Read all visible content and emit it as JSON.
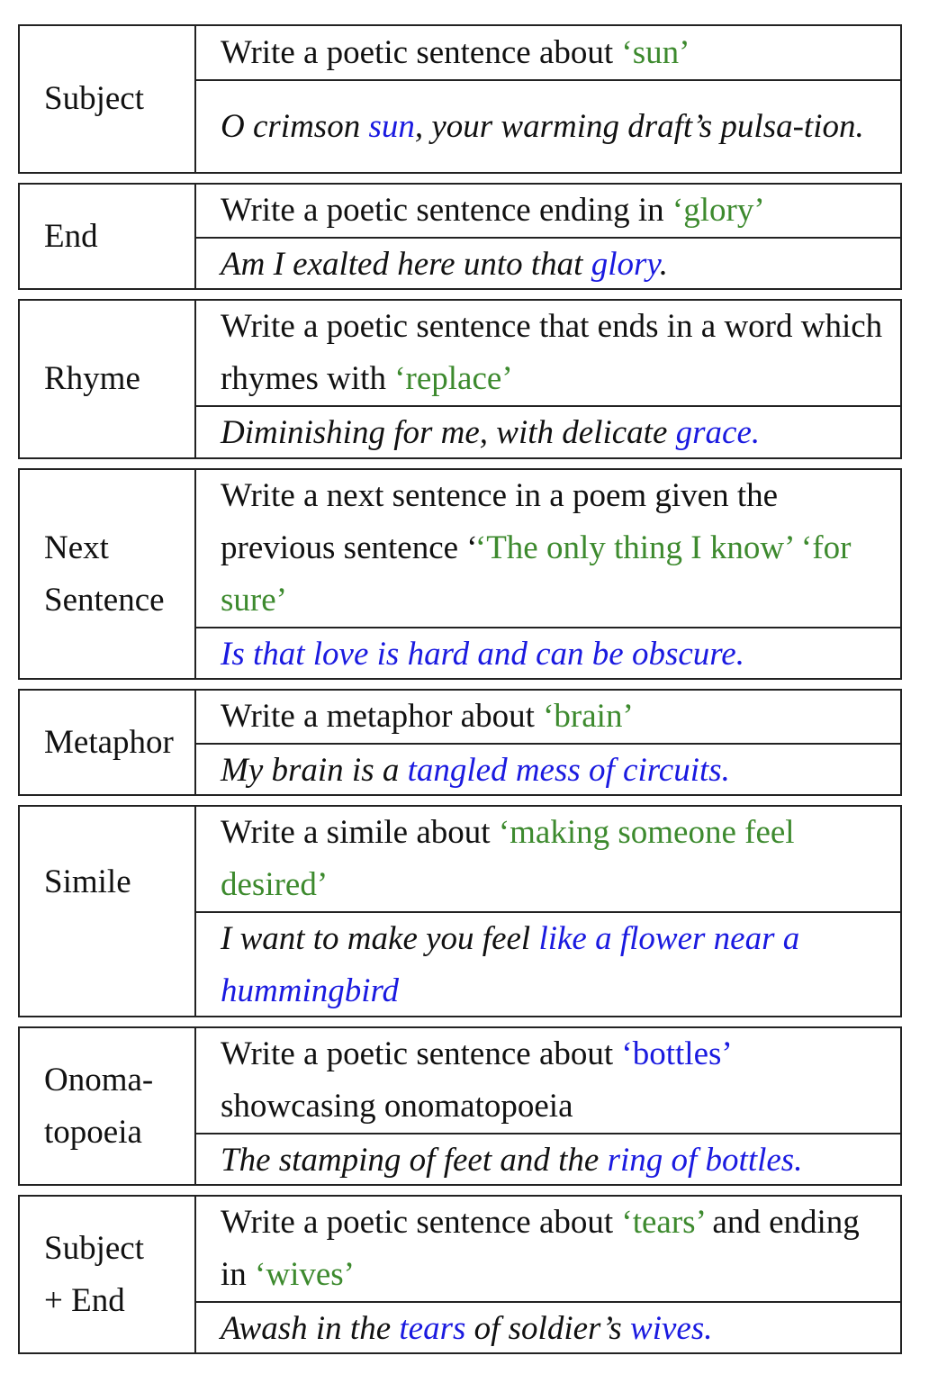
{
  "colors": {
    "green_keyword": "#3d8a2e",
    "blue_keyword": "#1a1ae0",
    "border": "#222222"
  },
  "rows": [
    {
      "label": "Subject",
      "instruction": [
        "Write a poetic sentence about ",
        "‘sun’"
      ],
      "response": [
        "O crimson ",
        "sun",
        ", your warming draft’s pulsa-tion."
      ]
    },
    {
      "label": "End",
      "instruction": [
        "Write a poetic sentence ending in ",
        "‘glory’"
      ],
      "response": [
        "Am I exalted here unto that ",
        "glory",
        "."
      ]
    },
    {
      "label": "Rhyme",
      "instruction": [
        "Write a poetic sentence that ends in a word which rhymes with ",
        "‘replace’"
      ],
      "response": [
        "Diminishing for me, with delicate ",
        "grace."
      ]
    },
    {
      "label": "Next Sentence",
      "instruction": [
        "Write a next sentence in a poem given the previous sentence ‘",
        "‘The only thing I know’ ‘for sure’"
      ],
      "response": [
        "Is that love is hard and can be obscure."
      ]
    },
    {
      "label": "Metaphor",
      "instruction": [
        "Write a metaphor about ",
        "‘brain’"
      ],
      "response": [
        "My brain is a ",
        "tangled mess of circuits."
      ]
    },
    {
      "label": "Simile",
      "instruction": [
        "Write a simile about ",
        "‘making someone feel desired’"
      ],
      "response": [
        "I want to make you feel ",
        "like a flower near a hummingbird"
      ]
    },
    {
      "label": "Onoma-topoeia",
      "instruction": [
        "Write a poetic sentence about ",
        "‘bottles’",
        " showcasing onomatopoeia"
      ],
      "response": [
        "The stamping of feet and the ",
        "ring of bottles."
      ]
    },
    {
      "label": "Subject + End",
      "instruction": [
        "Write a poetic sentence about ",
        "‘tears’",
        " and ending in ",
        "‘wives’"
      ],
      "response": [
        "Awash in the ",
        "tears",
        " of soldier’s ",
        "wives."
      ]
    }
  ]
}
